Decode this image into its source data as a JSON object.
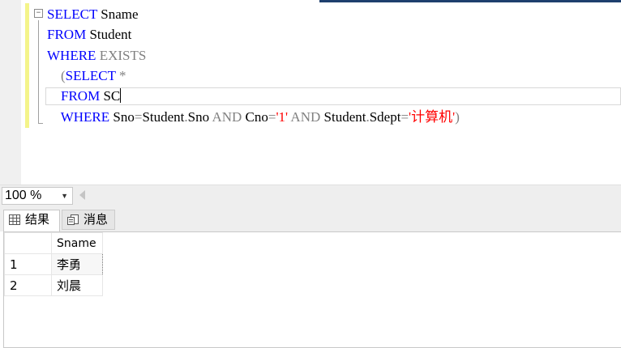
{
  "editor": {
    "lines": [
      [
        {
          "t": "SELECT",
          "c": "kw"
        },
        {
          "t": " Sname",
          "c": ""
        }
      ],
      [
        {
          "t": "FROM",
          "c": "kw"
        },
        {
          "t": " Student",
          "c": ""
        }
      ],
      [
        {
          "t": "WHERE",
          "c": "kw"
        },
        {
          "t": " EXISTS",
          "c": "gr"
        }
      ],
      [
        {
          "t": "    (",
          "c": "gr"
        },
        {
          "t": "SELECT",
          "c": "kw"
        },
        {
          "t": " *",
          "c": "gr"
        }
      ],
      [
        {
          "t": "    ",
          "c": ""
        },
        {
          "t": "FROM",
          "c": "kw"
        },
        {
          "t": " SC",
          "c": ""
        }
      ],
      [
        {
          "t": "    ",
          "c": ""
        },
        {
          "t": "WHERE",
          "c": "kw"
        },
        {
          "t": " Sno",
          "c": ""
        },
        {
          "t": "=",
          "c": "gr"
        },
        {
          "t": "Student",
          "c": ""
        },
        {
          "t": ".",
          "c": "gr"
        },
        {
          "t": "Sno ",
          "c": ""
        },
        {
          "t": "AND",
          "c": "gr"
        },
        {
          "t": " Cno",
          "c": ""
        },
        {
          "t": "=",
          "c": "gr"
        },
        {
          "t": "'1'",
          "c": "st"
        },
        {
          "t": " AND",
          "c": "gr"
        },
        {
          "t": " Student",
          "c": ""
        },
        {
          "t": ".",
          "c": "gr"
        },
        {
          "t": "Sdept",
          "c": ""
        },
        {
          "t": "=",
          "c": "gr"
        },
        {
          "t": "'计算机'",
          "c": "st"
        },
        {
          "t": ")",
          "c": "gr"
        }
      ]
    ],
    "caret_line": 4,
    "collapse_symbol": "−"
  },
  "zoom": {
    "value": "100 %",
    "arrow": "▼"
  },
  "tabs": {
    "results": "结果",
    "messages": "消息"
  },
  "grid": {
    "column": "Sname",
    "rows": [
      {
        "num": "1",
        "value": "李勇"
      },
      {
        "num": "2",
        "value": "刘晨"
      }
    ]
  },
  "colors": {
    "keyword": "#0000ff",
    "operator": "#808080",
    "string": "#ff0000",
    "change_bar": "#f4f48a"
  }
}
